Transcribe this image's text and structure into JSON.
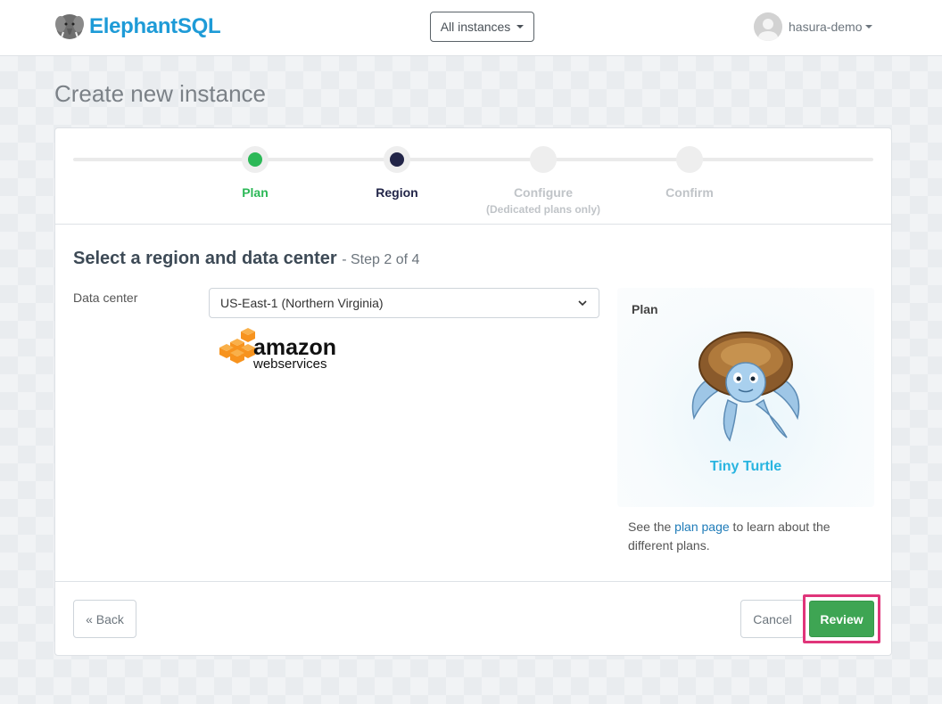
{
  "navbar": {
    "brand_name": "ElephantSQL",
    "instances_label": "All instances",
    "user_name": "hasura-demo"
  },
  "page": {
    "title": "Create new instance"
  },
  "steps": [
    {
      "label": "Plan",
      "sub": "",
      "state": "done",
      "color": "#2cb857"
    },
    {
      "label": "Region",
      "sub": "",
      "state": "current",
      "color": "#222548"
    },
    {
      "label": "Configure",
      "sub": "(Dedicated plans only)",
      "state": "pending",
      "color": "#c0c4c8"
    },
    {
      "label": "Confirm",
      "sub": "",
      "state": "pending",
      "color": "#c0c4c8"
    }
  ],
  "section": {
    "title": "Select a region and data center",
    "subtitle": "- Step 2 of 4"
  },
  "form": {
    "data_center_label": "Data center",
    "data_center_value": "US-East-1 (Northern Virginia)",
    "provider_logo_text_top": "amazon",
    "provider_logo_text_bottom": "webservices"
  },
  "plan": {
    "heading": "Plan",
    "name": "Tiny Turtle",
    "note_prefix": "See the ",
    "note_link": "plan page",
    "note_suffix": " to learn about the different plans."
  },
  "footer": {
    "back_label": "« Back",
    "cancel_label": "Cancel",
    "review_label": "Review"
  },
  "colors": {
    "brand": "#1e9bd7",
    "step_done": "#2cb857",
    "step_current": "#222548",
    "review_button": "#3ea553",
    "highlight": "#e0357a",
    "plan_name": "#28b4e0"
  }
}
